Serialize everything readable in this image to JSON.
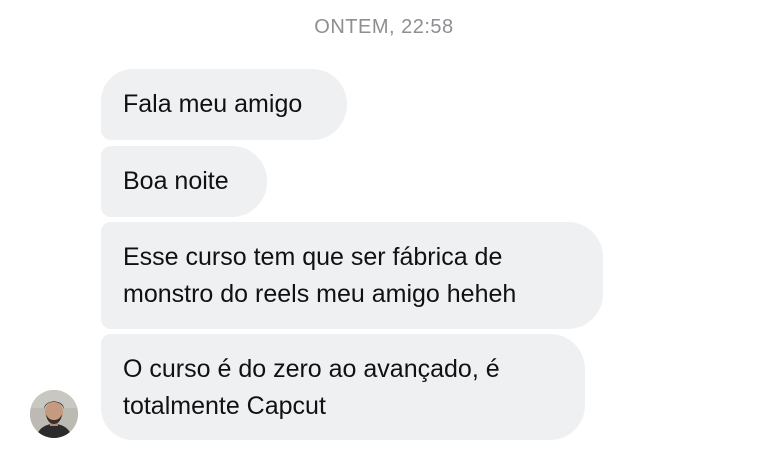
{
  "thread": {
    "timestamp": "ONTEM, 22:58"
  },
  "messages": [
    {
      "text": "Fala meu amigo"
    },
    {
      "text": "Boa noite"
    },
    {
      "text": "Esse curso tem que ser fábrica de\nmonstro do reels meu amigo heheh"
    },
    {
      "text": "O curso é do zero ao avançado, é\ntotalmente Capcut"
    }
  ],
  "colors": {
    "bubble_background": "#eff0f2",
    "timestamp_text": "#8e8e93",
    "message_text": "#111111"
  },
  "icons": {
    "sender_avatar": "avatar-photo"
  }
}
